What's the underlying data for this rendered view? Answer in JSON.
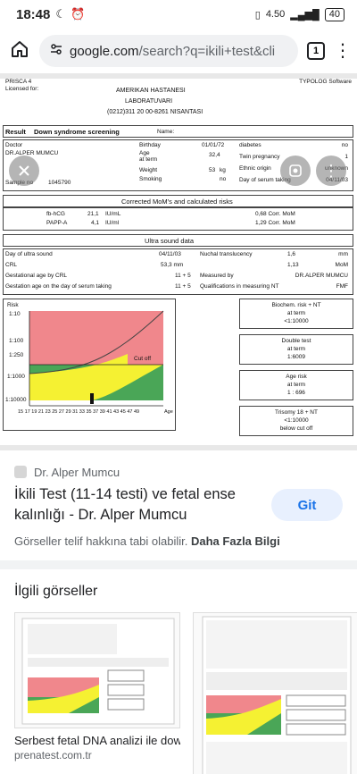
{
  "status": {
    "time": "18:48",
    "network": "4.50",
    "battery": "40"
  },
  "browser": {
    "url_host": "google.com",
    "url_rest": "/search?q=ikili+test&cli",
    "tab_count": "1"
  },
  "doc": {
    "prisca": "PRISCA 4",
    "licensed": "Licensed for:",
    "typolog": "TYPOLOG Software",
    "hospital": "AMERIKAN HASTANESI",
    "lab": "LABORATUVARI",
    "phone": "(0212)311 20 00-8261 NISANTASI",
    "result_label": "Result",
    "result_value": "Down syndrome screening",
    "name_label": "Name:",
    "doctor_label": "Doctor",
    "doctor_value": "DR.ALPER MUMCU",
    "birthday_label": "Birthday",
    "birthday_value": "01/01/72",
    "age_label": "Age",
    "age_sub": "at term",
    "age_value": "32,4",
    "weight_label": "Weight",
    "weight_value": "53",
    "weight_unit": "kg",
    "smoking_label": "Smoking",
    "smoking_value": "no",
    "sample_label": "Sample no",
    "sample_value": "1045790",
    "diabetes_label": "diabetes",
    "diabetes_value": "no",
    "twin_label": "Twin pregnancy",
    "twin_value": "1",
    "ethnic_label": "Ethnic origin",
    "ethnic_value": "unknown",
    "dayserum_label": "Day of serum taking",
    "dayserum_value": "04/11/03",
    "corrected_header": "Corrected MoM's and calculated risks",
    "fbhcg_label": "fb-hCG",
    "fbhcg_value": "21,1",
    "fbhcg_unit": "IU/mL",
    "fbhcg_mom": "0,68 Corr. MoM",
    "pappa_label": "PAPP-A",
    "pappa_value": "4,1",
    "pappa_unit": "IU/ml",
    "pappa_mom": "1,29 Corr. MoM",
    "us_header": "Ultra sound data",
    "dayus_label": "Day of ultra sound",
    "dayus_value": "04/11/03",
    "crl_label": "CRL",
    "crl_value": "53,3 mm",
    "gacrl_label": "Gestational age by CRL",
    "gacrl_value": "11 + 5",
    "gaserum_label": "Gestation age on the day of serum taking",
    "gaserum_value": "11 + 5",
    "nt_label": "Nuchal translucency",
    "nt_value": "1,6",
    "nt_unit": "mm",
    "nt_mom": "1,13",
    "nt_mom_unit": "MoM",
    "measured_label": "Measured by",
    "measured_value": "DR.ALPER MUMCU",
    "qual_label": "Qualifications in measuring NT",
    "qual_value": "FMF",
    "risk_label": "Risk",
    "risk_ticks": [
      "1:10",
      "1:100",
      "1:250",
      "1:1000",
      "1:10000"
    ],
    "age_ticks": "15 17 19 21 23 25 27 29 31 33 35 37 39 41 43 45 47 49",
    "age_axis": "Age",
    "cutoff": "Cut off",
    "biochem_title": "Biochem. risk + NT",
    "biochem_sub": "at term",
    "biochem_value": "<1:10000",
    "double_title": "Double test",
    "double_sub": "at term",
    "double_value": "1:6009",
    "agerisk_title": "Age risk",
    "agerisk_sub": "at term",
    "agerisk_value": "1 : 696",
    "trisomy_title": "Trisomy 18 + NT",
    "trisomy_value": "<1:10000",
    "trisomy_sub": "below cut off"
  },
  "result": {
    "source": "Dr. Alper Mumcu",
    "title": "İkili Test (11-14 testi) ve fetal ense kalınlığı - Dr. Alper Mumcu",
    "visit": "Git",
    "copyright": "Görseller telif hakkına tabi olabilir.",
    "more": "Daha Fazla Bilgi"
  },
  "related": {
    "title": "İlgili görseller",
    "items": [
      {
        "caption": "Serbest fetal DNA analizi ile dow...",
        "site": "prenatest.com.tr"
      },
      {
        "caption": "",
        "site": ""
      }
    ]
  },
  "colors": {
    "risk_red": "#f0878c",
    "risk_yellow": "#f5f132",
    "risk_green": "#4aa657",
    "accent": "#1a73e8"
  }
}
